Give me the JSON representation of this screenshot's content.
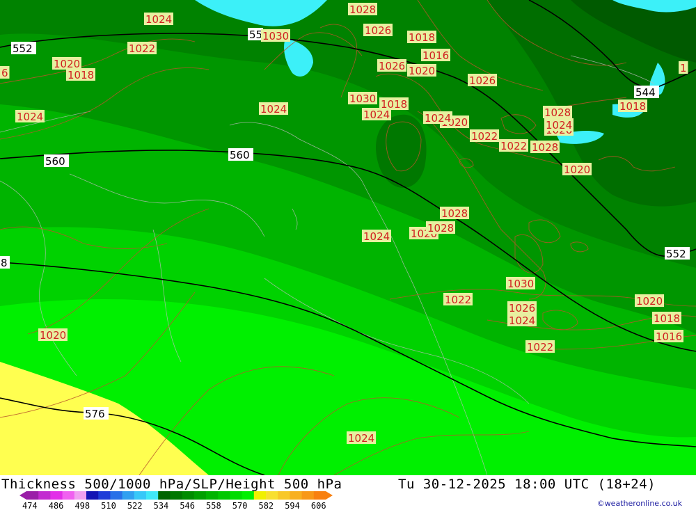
{
  "footer": {
    "title": "Thickness 500/1000 hPa/SLP/Height 500 hPa",
    "datetime": "Tu 30-12-2025 18:00 UTC (18+24)",
    "credit": "©weatheronline.co.uk"
  },
  "scale": {
    "ticks": [
      "474",
      "486",
      "498",
      "510",
      "522",
      "534",
      "546",
      "558",
      "570",
      "582",
      "594",
      "606"
    ],
    "colors": [
      "#9a1fa8",
      "#c22bd0",
      "#e22ee8",
      "#f060f0",
      "#f0a0f0",
      "#1414b4",
      "#1e3cd8",
      "#2870e8",
      "#30a0f0",
      "#38c8f8",
      "#40e8f8",
      "#006400",
      "#007800",
      "#008c00",
      "#00a000",
      "#00b400",
      "#00c800",
      "#00dc00",
      "#00f000",
      "#f0f000",
      "#f8e030",
      "#f8c828",
      "#f8b020",
      "#f89818",
      "#f88010"
    ]
  },
  "map": {
    "fill_colors": {
      "band_534": "#006e00",
      "band_540": "#008200",
      "band_546": "#009600",
      "band_552": "#00b400",
      "band_558": "#00d200",
      "band_564": "#00f000",
      "band_576": "#ffff50",
      "water": "#3cf0f8"
    },
    "height_labels": [
      "552",
      "560",
      "544",
      "552",
      "576",
      "8",
      "55"
    ],
    "pressure_labels": [
      "1024",
      "1028",
      "1030",
      "1026",
      "1018",
      "1022",
      "1020",
      "1018",
      "1024",
      "1026",
      "1020",
      "1016",
      "1026",
      "1024",
      "1030",
      "1018",
      "1028",
      "1024",
      "1026",
      "1020",
      "1022",
      "1022",
      "1028",
      "1024",
      "1020",
      "1018",
      "1024",
      "1020",
      "1028",
      "1028",
      "1030",
      "1022",
      "1026",
      "1020",
      "1024",
      "1018",
      "1016",
      "1022",
      "1020",
      "1024",
      "1024",
      "6",
      "1"
    ]
  }
}
